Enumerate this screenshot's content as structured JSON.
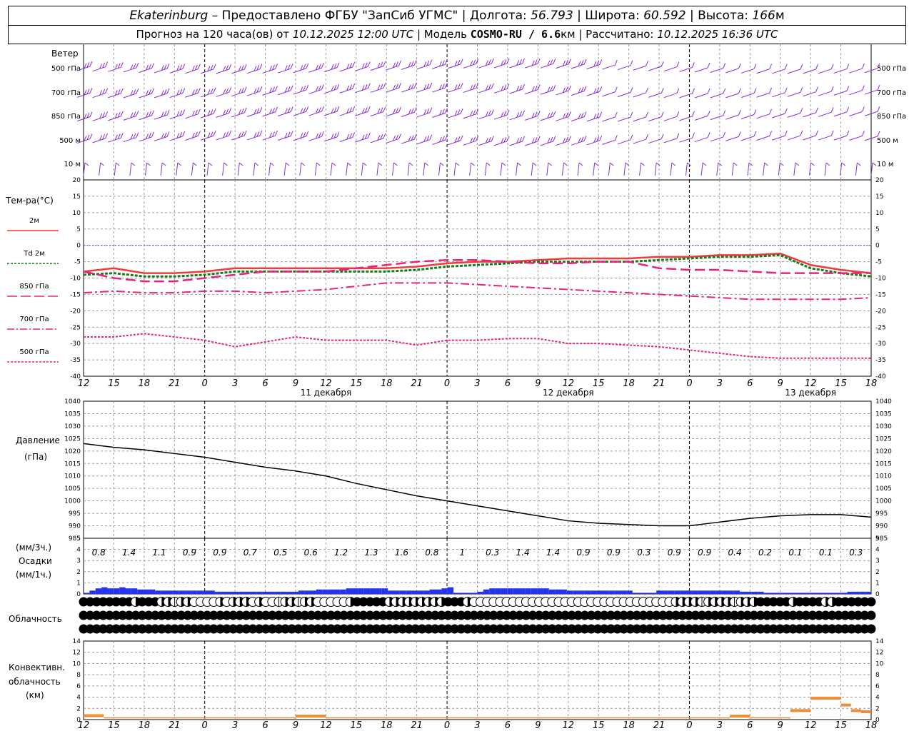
{
  "header": {
    "station": "Ekaterinburg",
    "provider": "– Предоставлено ФГБУ \"ЗапСиб УГМС\"",
    "lon_label": "Долгота:",
    "lon": "56.793",
    "lat_label": "Широта:",
    "lat": "60.592",
    "alt_label": "Высота:",
    "alt": "166",
    "alt_unit": "м",
    "forecast_prefix": "Прогноз на 120 часа(ов) от",
    "init_time": "10.12.2025 12:00 UTC",
    "model_label": "Модель",
    "model": "COSMO-RU / 6.6",
    "model_unit": "км",
    "calc_label": "Рассчитано:",
    "calc_time": "10.12.2025 16:36 UTC"
  },
  "labels": {
    "wind": "Ветер",
    "wind_levels": [
      "500 гПа",
      "700 гПа",
      "850 гПа",
      "500 м",
      "10  м"
    ],
    "temp_title": "Тем-ра(°С)",
    "pressure_title": "Давление",
    "pressure_unit": "(гПа)",
    "precip_unit3": "(мм/3ч.)",
    "precip_title": "Осадки",
    "precip_unit1": "(мм/1ч.)",
    "cloud_title": "Облачность",
    "conv_title1": "Конвективн.",
    "conv_title2": "облачность",
    "conv_unit": "(км)"
  },
  "time_axis": {
    "hour_labels": [
      "12",
      "15",
      "18",
      "21",
      "0",
      "3",
      "6",
      "9",
      "12",
      "15",
      "18",
      "21",
      "0",
      "3",
      "6",
      "9",
      "12",
      "15",
      "18",
      "21",
      "0",
      "3",
      "6",
      "9",
      "12",
      "15",
      "18"
    ],
    "date_labels": [
      "11 декабря",
      "12 декабря",
      "13 декабря"
    ]
  },
  "colors": {
    "wind": "#8b2bd8",
    "t2m": "#ef3b3b",
    "td2m": "#1a7a1a",
    "t850": "#e8237f",
    "t700": "#e8237f",
    "t500": "#e8237f",
    "pressure": "#000000",
    "precip": "#2433ee",
    "conv": "#ef8a35",
    "zero_line": "#3b5bdb",
    "grid": "#9a9a9a"
  },
  "chart_data": [
    {
      "type": "line",
      "title": "Тем-ра(°С)",
      "ylim": [
        -40,
        20
      ],
      "x_hours_from_start": [
        0,
        3,
        6,
        9,
        12,
        15,
        18,
        21,
        24,
        27,
        30,
        33,
        36,
        39,
        42,
        45,
        48,
        51,
        54,
        57,
        60,
        63,
        66,
        69,
        72,
        75,
        78
      ],
      "series": [
        {
          "name": "2м",
          "values": [
            -8,
            -7,
            -8.5,
            -8.5,
            -8,
            -7,
            -7,
            -7,
            -7,
            -7,
            -7,
            -6.5,
            -5.5,
            -5,
            -5,
            -4.5,
            -4,
            -4,
            -4,
            -3.5,
            -3.5,
            -3,
            -3,
            -2.5,
            -6,
            -7.5,
            -8.5
          ]
        },
        {
          "name": "Td 2м",
          "values": [
            -9,
            -8.5,
            -9.5,
            -9.5,
            -9,
            -8,
            -8,
            -8,
            -8,
            -8,
            -8,
            -7.5,
            -6.5,
            -6,
            -5.5,
            -5,
            -5,
            -5,
            -5,
            -4.5,
            -4,
            -3.5,
            -3.5,
            -3,
            -7,
            -8.5,
            -9.5
          ]
        },
        {
          "name": "850 гПа",
          "values": [
            -8,
            -10,
            -11,
            -11,
            -10,
            -9,
            -8,
            -8,
            -8,
            -7,
            -6,
            -5,
            -4.5,
            -4.5,
            -5,
            -5.5,
            -5.5,
            -5,
            -5,
            -7,
            -7.5,
            -7.5,
            -8,
            -8.5,
            -8.5,
            -8.5,
            -8.5
          ]
        },
        {
          "name": "700 гПа",
          "values": [
            -14.5,
            -14,
            -14.5,
            -14.5,
            -14,
            -14,
            -14.5,
            -14,
            -13.5,
            -12.5,
            -11.5,
            -11.5,
            -11.5,
            -12,
            -12.5,
            -13,
            -13.5,
            -14,
            -14.5,
            -15,
            -15.5,
            -16,
            -16.5,
            -16.5,
            -16.5,
            -16.5,
            -16
          ]
        },
        {
          "name": "500 гПа",
          "values": [
            -28,
            -28,
            -27,
            -28,
            -29,
            -31,
            -29.5,
            -28,
            -29,
            -29,
            -29,
            -30.5,
            -29,
            -29,
            -28.5,
            -28.5,
            -30,
            -30,
            -30.5,
            -31,
            -32,
            -33,
            -34,
            -34.5,
            -34.5,
            -34.5,
            -34.5
          ]
        }
      ]
    },
    {
      "type": "line",
      "title": "Давление",
      "ylabel": "(гПа)",
      "ylim": [
        985,
        1040
      ],
      "x_hours_from_start": [
        0,
        3,
        6,
        9,
        12,
        15,
        18,
        21,
        24,
        27,
        30,
        33,
        36,
        39,
        42,
        45,
        48,
        51,
        54,
        57,
        60,
        63,
        66,
        69,
        72,
        75,
        78
      ],
      "series": [
        {
          "name": "Давление",
          "values": [
            1023,
            1021.5,
            1020.5,
            1019,
            1017.5,
            1015.5,
            1013.5,
            1012,
            1010,
            1007,
            1004.5,
            1002,
            1000,
            998,
            996,
            994,
            992,
            991,
            990.5,
            990,
            990,
            991.5,
            993,
            994,
            994.5,
            994.5,
            993.5
          ]
        }
      ]
    },
    {
      "type": "bar",
      "title": "Осадки",
      "ylim": [
        0,
        5
      ],
      "totals_3h": [
        "0.8",
        "1.4",
        "1.1",
        "0.9",
        "0.9",
        "0.7",
        "0.5",
        "0.6",
        "1.2",
        "1.3",
        "1.6",
        "0.8",
        "1",
        "0.3",
        "1.4",
        "1.4",
        "0.9",
        "0.9",
        "0.3",
        "0.9",
        "0.9",
        "0.4",
        "0.2",
        "0.1",
        "0.1",
        "0.3"
      ],
      "hourly_mm": [
        0.1,
        0.3,
        0.5,
        0.6,
        0.5,
        0.5,
        0.6,
        0.5,
        0.5,
        0.4,
        0.4,
        0.4,
        0.3,
        0.3,
        0.3,
        0.3,
        0.3,
        0.3,
        0.3,
        0.3,
        0.3,
        0.3,
        0.2,
        0.2,
        0.2,
        0.2,
        0.2,
        0.2,
        0.2,
        0.2,
        0.2,
        0.2,
        0.2,
        0.2,
        0.2,
        0.2,
        0.3,
        0.3,
        0.3,
        0.4,
        0.4,
        0.4,
        0.4,
        0.4,
        0.5,
        0.5,
        0.5,
        0.5,
        0.5,
        0.5,
        0.5,
        0.3,
        0.3,
        0.3,
        0.3,
        0.3,
        0.3,
        0.3,
        0.4,
        0.4,
        0.5,
        0.6,
        0.1,
        0.1,
        0.1,
        0.1,
        0.2,
        0.4,
        0.5,
        0.5,
        0.5,
        0.5,
        0.5,
        0.5,
        0.5,
        0.5,
        0.5,
        0.5,
        0.4,
        0.4,
        0.4,
        0.3,
        0.3,
        0.3,
        0.3,
        0.3,
        0.3,
        0.3,
        0.3,
        0.3,
        0.3,
        0.3,
        0.1,
        0.1,
        0.1,
        0.1,
        0.3,
        0.3,
        0.3,
        0.3,
        0.3,
        0.3,
        0.3,
        0.3,
        0.3,
        0.3,
        0.3,
        0.3,
        0.3,
        0.3,
        0.2,
        0.2,
        0.2,
        0.2,
        0.1,
        0.1,
        0.1,
        0.1,
        0.1,
        0.1,
        0.1,
        0.1,
        0.1,
        0.1,
        0.1,
        0.1,
        0.1,
        0.1,
        0.2,
        0.2,
        0.2,
        0.2
      ]
    },
    {
      "type": "bar",
      "title": "Конвективн. облачность",
      "ylabel": "(км)",
      "ylim": [
        0,
        14
      ],
      "segments": [
        {
          "start_h": 0,
          "end_h": 2,
          "value": 0.7
        },
        {
          "start_h": 2,
          "end_h": 21,
          "value": 0.3
        },
        {
          "start_h": 21,
          "end_h": 24,
          "value": 0.6
        },
        {
          "start_h": 24,
          "end_h": 64,
          "value": 0.3
        },
        {
          "start_h": 64,
          "end_h": 66,
          "value": 0.6
        },
        {
          "start_h": 66,
          "end_h": 70,
          "value": 0.3
        },
        {
          "start_h": 70,
          "end_h": 72,
          "value": 1.6
        },
        {
          "start_h": 72,
          "end_h": 75,
          "value": 3.8
        },
        {
          "start_h": 75,
          "end_h": 76,
          "value": 2.6
        },
        {
          "start_h": 76,
          "end_h": 77,
          "value": 1.6
        },
        {
          "start_h": 77,
          "end_h": 78,
          "value": 1.4
        }
      ]
    }
  ],
  "cloud_rows": [
    "FFFFFFFFHFFFHHQHHEEEEHEHHHEHEEQHHQHHEEEEEHFFFFFHHHHHHHHHFFFHEEEEEEEEEEEEEEEEEEEEEEEEEEEEEEEHHHHQHHHHQHHHFFFFFHFFFFHHFFFFFF",
    "FFFFFFFFFFFFFFFFFFFFFFFFFFFFFFFFFFFFFFFFFFFFFFFFFFFFFFFFFFFFFFFFFFFFFFFFFFFFFFFFFFFFFFFFFFFFFFFFFFFFFFFFFFFFFFFFFFFFFFFFFF",
    "FFFFFFFFFFFFFFFFFFFFFFFFFFFFFFFFFFFFFFFFFFFFFFFFFFFFFFFFFFFFFFFFFFFFFFFFFFFFFFFFFFFFFFFFFFFFFFFFFFFFFFFFFFFFFFFFFFFFFFFFFF"
  ]
}
